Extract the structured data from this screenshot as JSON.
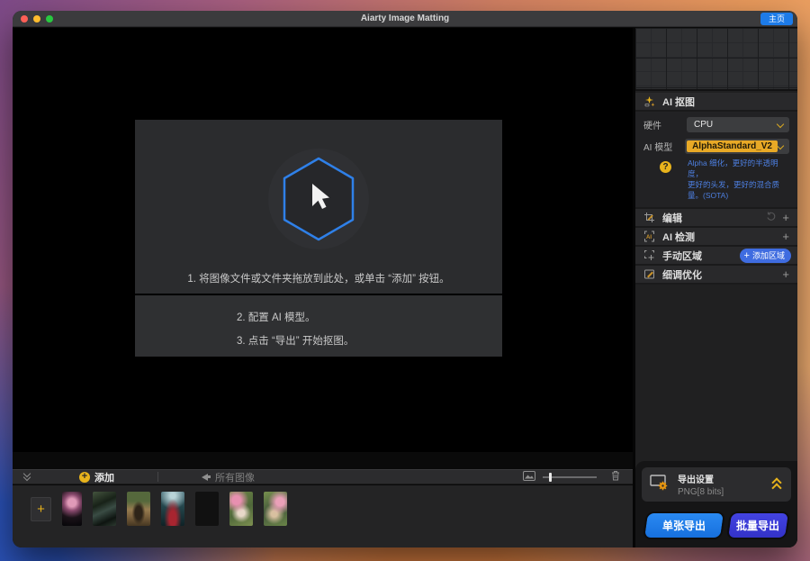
{
  "window": {
    "title": "Aiarty Image Matting",
    "home_button": "主页"
  },
  "dropzone": {
    "instructions": [
      "1. 将图像文件或文件夹拖放到此处，或单击 “添加” 按钮。",
      "2. 配置 AI 模型。",
      "3. 点击 “导出” 开始抠图。"
    ]
  },
  "toolbar": {
    "add_label": "添加",
    "all_images_label": "所有图像"
  },
  "sidebar": {
    "matting": {
      "title": "AI 抠图",
      "hardware_label": "硬件",
      "hardware_value": "CPU",
      "model_label": "AI 模型",
      "model_value": "AlphaStandard_V2",
      "hint_line1": "Alpha 细化，更好的半透明度，",
      "hint_line2": "更好的头发，更好的混合质量。(SOTA)"
    },
    "panels": [
      {
        "label": "编辑"
      },
      {
        "label": "AI 检测"
      },
      {
        "label": "手动区域",
        "button_label": "添加区域"
      },
      {
        "label": "细调优化"
      }
    ]
  },
  "export": {
    "settings_title": "导出设置",
    "format": "PNG[8 bits]",
    "single_label": "单张导出",
    "batch_label": "批量导出"
  },
  "colors": {
    "accent_blue": "#1d7be8",
    "accent_yellow": "#e8b31c",
    "model_highlight": "#e8a926",
    "batch_indigo": "#3c3ad8",
    "hint_blue": "#4d7fe0",
    "region_button_blue": "#3f6ce0"
  },
  "filmstrip": {
    "thumbnail_count": 7
  }
}
